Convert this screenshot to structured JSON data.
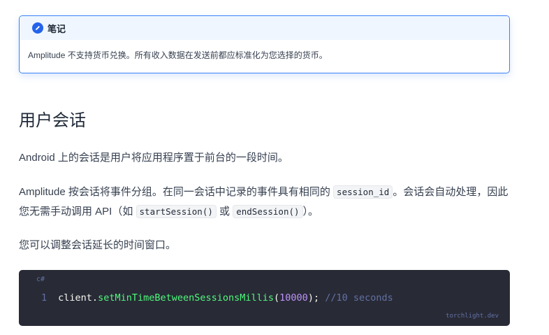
{
  "note": {
    "title": "笔记",
    "icon": "pencil-icon",
    "body": "Amplitude 不支持货币兑换。所有收入数据在发送前都应标准化为您选择的货币。"
  },
  "section": {
    "heading": "用户会话",
    "para1": "Android 上的会话是用户将应用程序置于前台的一段时间。",
    "para2": {
      "t1": "Amplitude 按会话将事件分组。在同一会话中记录的事件具有相同的 ",
      "code1": "session_id",
      "t2": "。会话会自动处理，因此您无需手动调用 API（如 ",
      "code2": "startSession()",
      "t3": " 或 ",
      "code3": "endSession()",
      "t4": "）。"
    },
    "para3": "您可以调整会话延长的时间窗口。"
  },
  "code_block": {
    "language": "c#",
    "line_number": "1",
    "tokens": {
      "obj": "client",
      "dot": ".",
      "method": "setMinTimeBetweenSessionsMillis",
      "open": "(",
      "arg": "10000",
      "close": ");",
      "comment": "//10 seconds"
    },
    "brand": "torchlight.dev"
  }
}
